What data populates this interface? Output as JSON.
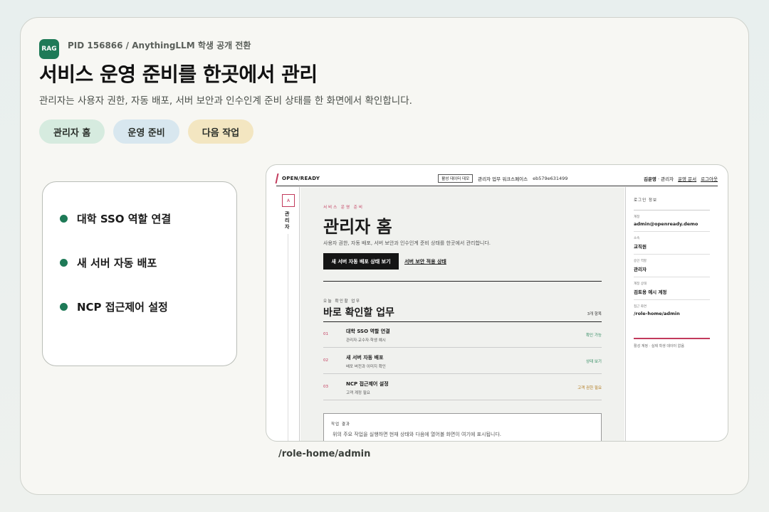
{
  "header": {
    "badge": "RAG",
    "pid_line": "PID 156866 / AnythingLLM 학생 공개 전환",
    "title": "서비스 운영 준비를 한곳에서 관리",
    "subtitle": "관리자는 사용자 권한, 자동 배포, 서버 보안과 인수인계 준비 상태를 한 화면에서 확인합니다."
  },
  "pills": [
    "관리자 홈",
    "운영 준비",
    "다음 작업"
  ],
  "task_list": [
    "대학 SSO 역할 연결",
    "새 서버 자동 배포",
    "NCP 접근제어 설정"
  ],
  "app": {
    "brand": "OPEN/READY",
    "demo_badge": "활성 데이터 데모",
    "workspace_label": "관리자 업무 워크스페이스",
    "workspace_id": "eb579e631499",
    "user": "김운영",
    "user_role": "· 관리자",
    "ops_docs": "운영 문서",
    "logout": "로그아웃",
    "rail_box": "A",
    "rail_label": "관리자",
    "crumb": "서비스 운영 준비",
    "main_title": "관리자 홈",
    "main_desc": "사용자 권한, 자동 배포, 서버 보안과 인수인계 준비 상태를 한곳에서 관리합니다.",
    "cta_primary": "새 서버 자동 배포 상태 보기",
    "cta_secondary": "서버 보안 적용 상태",
    "eyebrow": "오늘 확인할 업무",
    "section_title": "바로 확인할 업무",
    "section_count": "3개 항목",
    "rows": [
      {
        "no": "01",
        "title": "대학 SSO 역할 연결",
        "sub": "관리자·교수자·학생 예시",
        "status": "확인 가능",
        "color": "#2f8a5f"
      },
      {
        "no": "02",
        "title": "새 서버 자동 배포",
        "sub": "배포 버전과 이미지 확인",
        "status": "상태 보기",
        "color": "#2f8a5f"
      },
      {
        "no": "03",
        "title": "NCP 접근제어 설정",
        "sub": "고객 계정 필요",
        "status": "고객 권한 필요",
        "color": "#b07a1e"
      }
    ],
    "result_heading": "작업 결과",
    "result_body": "위의 주요 작업을 실행하면 현재 상태와 다음에 열어볼 화면이 여기에 표시됩니다.",
    "login_info": {
      "heading": "로그인 정보",
      "fields": [
        {
          "k": "계정",
          "v": "admin@openready.demo"
        },
        {
          "k": "소속",
          "v": "교직원"
        },
        {
          "k": "승인 역할",
          "v": "관리자"
        },
        {
          "k": "계정 상태",
          "v": "검토용 예시 계정"
        },
        {
          "k": "접근 화면",
          "v": "/role-home/admin"
        }
      ],
      "note": "활성 계정 · 실제 학생 데이터 없음"
    }
  },
  "path_caption": "/role-home/admin"
}
